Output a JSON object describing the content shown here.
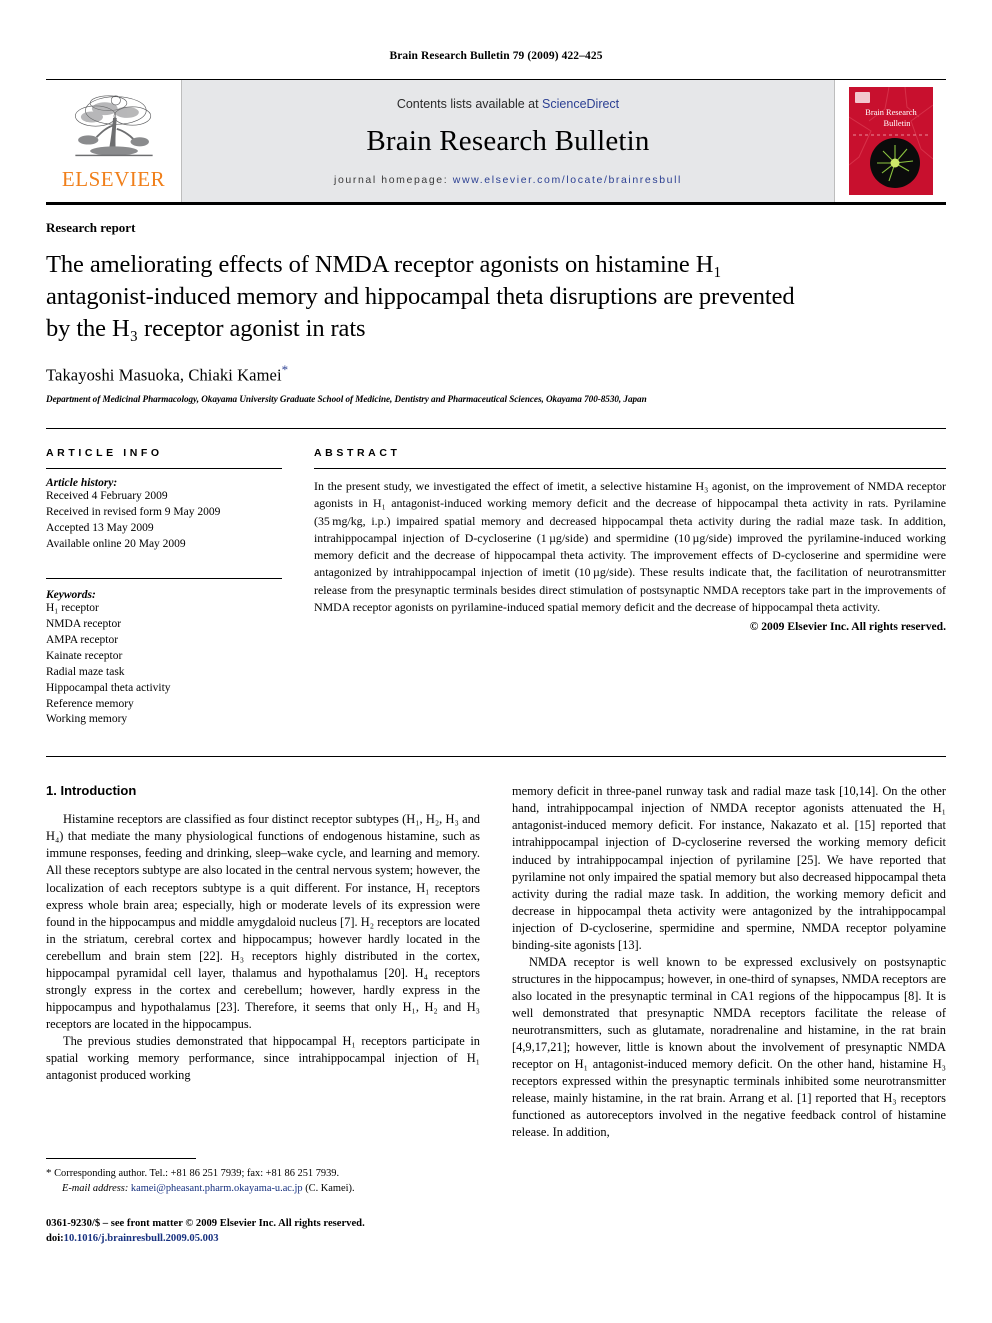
{
  "running_head": "Brain Research Bulletin 79 (2009) 422–425",
  "masthead": {
    "publisher_logo_label": "ELSEVIER",
    "contents_prefix": "Contents lists available at ",
    "contents_link": "ScienceDirect",
    "journal_title": "Brain Research Bulletin",
    "homepage_prefix": "journal homepage:",
    "homepage_url": "www.elsevier.com/locate/brainresbull",
    "cover_title_line1": "Brain Research",
    "cover_title_line2": "Bulletin",
    "cover_color": "#c8102e",
    "link_color": "#2b3f92",
    "elsevier_orange": "#F07F1A"
  },
  "article": {
    "doctype": "Research report",
    "title": "The ameliorating effects of NMDA receptor agonists on histamine H₁ antagonist-induced memory and hippocampal theta disruptions are prevented by the H₃ receptor agonist in rats",
    "authors": "Takayoshi Masuoka, Chiaki Kamei",
    "corresponding_marker": "*",
    "affiliation": "Department of Medicinal Pharmacology, Okayama University Graduate School of Medicine, Dentistry and Pharmaceutical Sciences, Okayama 700-8530, Japan"
  },
  "article_info": {
    "heading": "ARTICLE INFO",
    "history_label": "Article history:",
    "history": [
      "Received 4 February 2009",
      "Received in revised form 9 May 2009",
      "Accepted 13 May 2009",
      "Available online 20 May 2009"
    ],
    "keywords_label": "Keywords:",
    "keywords": [
      "H₁ receptor",
      "NMDA receptor",
      "AMPA receptor",
      "Kainate receptor",
      "Radial maze task",
      "Hippocampal theta activity",
      "Reference memory",
      "Working memory"
    ]
  },
  "abstract": {
    "heading": "ABSTRACT",
    "text": "In the present study, we investigated the effect of imetit, a selective histamine H₃ agonist, on the improvement of NMDA receptor agonists in H₁ antagonist-induced working memory deficit and the decrease of hippocampal theta activity in rats. Pyrilamine (35 mg/kg, i.p.) impaired spatial memory and decreased hippocampal theta activity during the radial maze task. In addition, intrahippocampal injection of D-cycloserine (1 µg/side) and spermidine (10 µg/side) improved the pyrilamine-induced working memory deficit and the decrease of hippocampal theta activity. The improvement effects of D-cycloserine and spermidine were antagonized by intrahippocampal injection of imetit (10 µg/side). These results indicate that, the facilitation of neurotransmitter release from the presynaptic terminals besides direct stimulation of postsynaptic NMDA receptors take part in the improvements of NMDA receptor agonists on pyrilamine-induced spatial memory deficit and the decrease of hippocampal theta activity.",
    "copyright": "© 2009 Elsevier Inc. All rights reserved."
  },
  "body": {
    "section_heading": "1. Introduction",
    "left_paragraphs": [
      "Histamine receptors are classified as four distinct receptor subtypes (H₁, H₂, H₃ and H₄) that mediate the many physiological functions of endogenous histamine, such as immune responses, feeding and drinking, sleep–wake cycle, and learning and memory. All these receptors subtype are also located in the central nervous system; however, the localization of each receptors subtype is a quit different. For instance, H₁ receptors express whole brain area; especially, high or moderate levels of its expression were found in the hippocampus and middle amygdaloid nucleus [7]. H₂ receptors are located in the striatum, cerebral cortex and hippocampus; however hardly located in the cerebellum and brain stem [22]. H₃ receptors highly distributed in the cortex, hippocampal pyramidal cell layer, thalamus and hypothalamus [20]. H₄ receptors strongly express in the cortex and cerebellum; however, hardly express in the hippocampus and hypothalamus [23]. Therefore, it seems that only H₁, H₂ and H₃ receptors are located in the hippocampus.",
      "The previous studies demonstrated that hippocampal H₁ receptors participate in spatial working memory performance, since intrahippocampal injection of H₁ antagonist produced working"
    ],
    "right_paragraphs": [
      "memory deficit in three-panel runway task and radial maze task [10,14]. On the other hand, intrahippocampal injection of NMDA receptor agonists attenuated the H₁ antagonist-induced memory deficit. For instance, Nakazato et al. [15] reported that intrahippocampal injection of D-cycloserine reversed the working memory deficit induced by intrahippocampal injection of pyrilamine [25]. We have reported that pyrilamine not only impaired the spatial memory but also decreased hippocampal theta activity during the radial maze task. In addition, the working memory deficit and decrease in hippocampal theta activity were antagonized by the intrahippocampal injection of D-cycloserine, spermidine and spermine, NMDA receptor polyamine binding-site agonists [13].",
      "NMDA receptor is well known to be expressed exclusively on postsynaptic structures in the hippocampus; however, in one-third of synapses, NMDA receptors are also located in the presynaptic terminal in CA1 regions of the hippocampus [8]. It is well demonstrated that presynaptic NMDA receptors facilitate the release of neurotransmitters, such as glutamate, noradrenaline and histamine, in the rat brain [4,9,17,21]; however, little is known about the involvement of presynaptic NMDA receptor on H₁ antagonist-induced memory deficit. On the other hand, histamine H₃ receptors expressed within the presynaptic terminals inhibited some neurotransmitter release, mainly histamine, in the rat brain. Arrang et al. [1] reported that H₃ receptors functioned as autoreceptors involved in the negative feedback control of histamine release. In addition,"
    ]
  },
  "footer": {
    "corresponding_note": "Corresponding author. Tel.: +81 86 251 7939; fax: +81 86 251 7939.",
    "email_label": "E-mail address:",
    "email": "kamei@pheasant.pharm.okayama-u.ac.jp",
    "email_suffix": "(C. Kamei).",
    "issn_line": "0361-9230/$ – see front matter © 2009 Elsevier Inc. All rights reserved.",
    "doi_label": "doi:",
    "doi": "10.1016/j.brainresbull.2009.05.003"
  }
}
